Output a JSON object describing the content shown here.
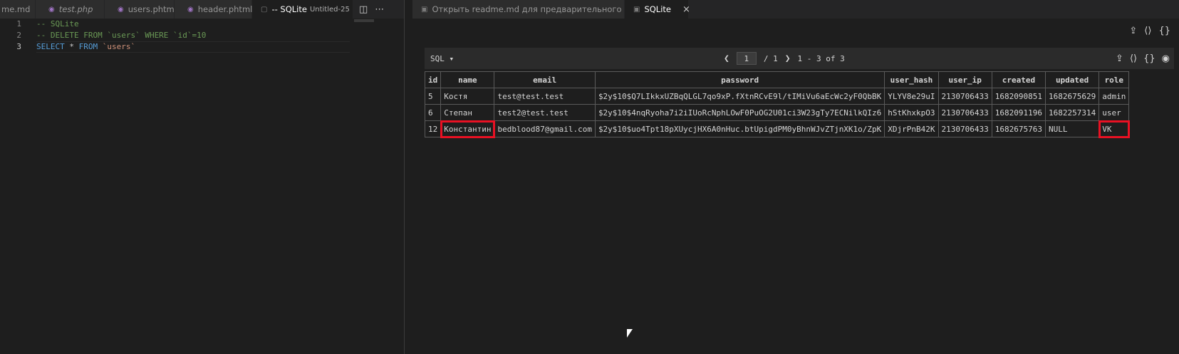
{
  "left_tabs": [
    {
      "label": "me.md",
      "icon": "markdown-icon",
      "italic": false,
      "active": false
    },
    {
      "label": "test.php",
      "icon": "php-icon",
      "italic": true,
      "active": false
    },
    {
      "label": "users.phtml",
      "icon": "php-icon",
      "italic": false,
      "active": false
    },
    {
      "label": "header.phtml",
      "icon": "php-icon",
      "italic": false,
      "active": false
    },
    {
      "label": "-- SQLite",
      "sublabel": "Untitled-25",
      "icon": "file-icon",
      "italic": false,
      "active": true,
      "dirty": true
    }
  ],
  "right_tabs": [
    {
      "label": "Открыть readme.md для предварительного просмотра",
      "icon": "preview-icon",
      "active": false
    },
    {
      "label": "SQLite",
      "icon": "preview-icon",
      "active": true
    }
  ],
  "editor": {
    "lines": [
      {
        "num": "1",
        "text": "-- SQLite"
      },
      {
        "num": "2",
        "text": "-- DELETE FROM `users` WHERE `id`=10"
      },
      {
        "num": "3",
        "kw1": "SELECT",
        "rest1": " * ",
        "kw2": "FROM",
        "ident": " `users`"
      }
    ]
  },
  "results": {
    "sql_label": "SQL ▾",
    "page_value": "1",
    "page_total": "/ 1",
    "range_text": "1 - 3 of 3",
    "columns": [
      "id",
      "name",
      "email",
      "password",
      "user_hash",
      "user_ip",
      "created",
      "updated",
      "role"
    ],
    "rows": [
      [
        "5",
        "Костя",
        "test@test.test",
        "$2y$10$Q7LIkkxUZBqQLGL7qo9xP.fXtnRCvE9l/tIMiVu6aEcWc2yF0QbBK",
        "YLYV8e29uI",
        "2130706433",
        "1682090851",
        "1682675629",
        "admin"
      ],
      [
        "6",
        "Степан",
        "test2@test.test",
        "$2y$10$4nqRyoha7i2iIUoRcNphLOwF0PuOG2U01ci3W23gTy7ECNilkQIz6",
        "hStKhxkpO3",
        "2130706433",
        "1682091196",
        "1682257314",
        "user"
      ],
      [
        "12",
        "Константин",
        "bedblood87@gmail.com",
        "$2y$10$uo4Tpt18pXUycjHX6A0nHuc.btUpigdPM0yBhnWJvZTjnXK1o/ZpK",
        "XDjrPnB42K",
        "2130706433",
        "1682675763",
        "NULL",
        "VK"
      ]
    ]
  },
  "colors": {
    "accent": "#569cd6",
    "highlight": "#e81123",
    "background": "#1e1e1e"
  }
}
